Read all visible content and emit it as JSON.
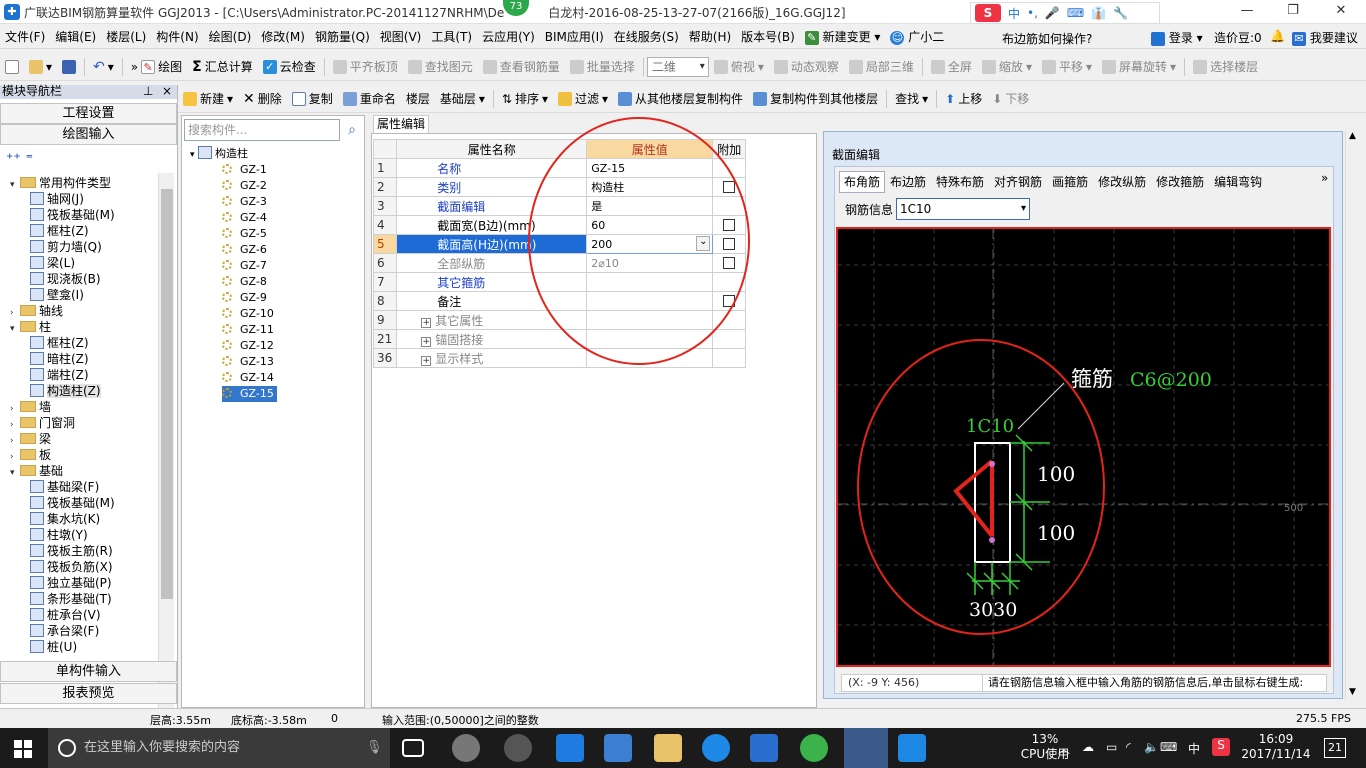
{
  "title_bar": {
    "title": "广联达BIM钢筋算量软件 GGJ2013 - [C:\\Users\\Administrator.PC-20141127NRHM\\De",
    "title_tail": "白龙村-2016-08-25-13-27-07(2166版)_16G.GGJ12]",
    "badge": "73",
    "ime_items": [
      "中",
      "•,",
      "🎤",
      "⌨",
      "👔",
      "🔧"
    ],
    "minimize": "—",
    "maximize": "❐",
    "close": "✕"
  },
  "menu": {
    "items": [
      "文件(F)",
      "编辑(E)",
      "楼层(L)",
      "构件(N)",
      "绘图(D)",
      "修改(M)",
      "钢筋量(Q)",
      "视图(V)",
      "工具(T)",
      "云应用(Y)",
      "BIM应用(I)",
      "在线服务(S)",
      "帮助(H)",
      "版本号(B)",
      "新建变更 ▾",
      "广小二"
    ],
    "help_question": "布边筋如何操作?",
    "login": "登录 ▾",
    "price_beans": "造价豆:0",
    "suggest": "我要建议"
  },
  "toolbar1": {
    "draw": "绘图",
    "summary": "汇总计算",
    "cloud_check": "云检查",
    "flush_slab": "平齐板顶",
    "find_element": "查找图元",
    "view_rebar": "查看钢筋量",
    "batch_select": "批量选择",
    "view_mode": "二维",
    "top_view": "俯视",
    "dynamic_view": "动态观察",
    "local_3d": "局部三维",
    "full_screen": "全屏",
    "zoom": "缩放",
    "pan": "平移",
    "rotate": "屏幕旋转",
    "select_floor": "选择楼层"
  },
  "toolbar2": {
    "new": "新建",
    "delete": "删除",
    "copy": "复制",
    "rename": "重命名",
    "floor_label": "楼层",
    "floor_value": "基础层",
    "sort": "排序",
    "filter": "过滤",
    "copy_from_floor": "从其他楼层复制构件",
    "copy_to_floor": "复制构件到其他楼层",
    "find": "查找",
    "move_up": "上移",
    "move_down": "下移"
  },
  "left_panel": {
    "header": "模块导航栏",
    "project_settings": "工程设置",
    "drawing_input": "绘图输入",
    "single_input": "单构件输入",
    "report_preview": "报表预览",
    "tree": [
      {
        "label": "常用构件类型",
        "level": 0,
        "type": "folder",
        "expanded": true
      },
      {
        "label": "轴网(J)",
        "level": 1,
        "type": "item"
      },
      {
        "label": "筏板基础(M)",
        "level": 1,
        "type": "item"
      },
      {
        "label": "框柱(Z)",
        "level": 1,
        "type": "item"
      },
      {
        "label": "剪力墙(Q)",
        "level": 1,
        "type": "item"
      },
      {
        "label": "梁(L)",
        "level": 1,
        "type": "item"
      },
      {
        "label": "现浇板(B)",
        "level": 1,
        "type": "item"
      },
      {
        "label": "壁龛(I)",
        "level": 1,
        "type": "item"
      },
      {
        "label": "轴线",
        "level": 0,
        "type": "folder",
        "expanded": false
      },
      {
        "label": "柱",
        "level": 0,
        "type": "folder",
        "expanded": true
      },
      {
        "label": "框柱(Z)",
        "level": 1,
        "type": "item"
      },
      {
        "label": "暗柱(Z)",
        "level": 1,
        "type": "item"
      },
      {
        "label": "端柱(Z)",
        "level": 1,
        "type": "item"
      },
      {
        "label": "构造柱(Z)",
        "level": 1,
        "type": "item",
        "selected": true
      },
      {
        "label": "墙",
        "level": 0,
        "type": "folder",
        "expanded": false
      },
      {
        "label": "门窗洞",
        "level": 0,
        "type": "folder",
        "expanded": false
      },
      {
        "label": "梁",
        "level": 0,
        "type": "folder",
        "expanded": false
      },
      {
        "label": "板",
        "level": 0,
        "type": "folder",
        "expanded": false
      },
      {
        "label": "基础",
        "level": 0,
        "type": "folder",
        "expanded": true
      },
      {
        "label": "基础梁(F)",
        "level": 1,
        "type": "item"
      },
      {
        "label": "筏板基础(M)",
        "level": 1,
        "type": "item"
      },
      {
        "label": "集水坑(K)",
        "level": 1,
        "type": "item"
      },
      {
        "label": "柱墩(Y)",
        "level": 1,
        "type": "item"
      },
      {
        "label": "筏板主筋(R)",
        "level": 1,
        "type": "item"
      },
      {
        "label": "筏板负筋(X)",
        "level": 1,
        "type": "item"
      },
      {
        "label": "独立基础(P)",
        "level": 1,
        "type": "item"
      },
      {
        "label": "条形基础(T)",
        "level": 1,
        "type": "item"
      },
      {
        "label": "桩承台(V)",
        "level": 1,
        "type": "item"
      },
      {
        "label": "承台梁(F)",
        "level": 1,
        "type": "item"
      },
      {
        "label": "桩(U)",
        "level": 1,
        "type": "item"
      }
    ]
  },
  "component_list": {
    "search_placeholder": "搜索构件...",
    "root": "构造柱",
    "items": [
      "GZ-1",
      "GZ-2",
      "GZ-3",
      "GZ-4",
      "GZ-5",
      "GZ-6",
      "GZ-7",
      "GZ-8",
      "GZ-9",
      "GZ-10",
      "GZ-11",
      "GZ-12",
      "GZ-13",
      "GZ-14",
      "GZ-15"
    ],
    "selected": "GZ-15"
  },
  "properties": {
    "tab": "属性编辑",
    "headers": {
      "name": "属性名称",
      "value": "属性值",
      "extra": "附加"
    },
    "rows": [
      {
        "num": "1",
        "name": "名称",
        "value": "GZ-15",
        "check": false,
        "style": "blue"
      },
      {
        "num": "2",
        "name": "类别",
        "value": "构造柱",
        "check": true,
        "style": "blue"
      },
      {
        "num": "3",
        "name": "截面编辑",
        "value": "是",
        "check": false,
        "style": "blue"
      },
      {
        "num": "4",
        "name": "截面宽(B边)(mm)",
        "value": "60",
        "check": true,
        "style": "black"
      },
      {
        "num": "5",
        "name": "截面高(H边)(mm)",
        "value": "200",
        "check": true,
        "style": "selected"
      },
      {
        "num": "6",
        "name": "全部纵筋",
        "value": "2⌀10",
        "check": true,
        "style": "grey"
      },
      {
        "num": "7",
        "name": "其它箍筋",
        "value": "",
        "check": false,
        "style": "blue"
      },
      {
        "num": "8",
        "name": "备注",
        "value": "",
        "check": true,
        "style": "black"
      },
      {
        "num": "9",
        "name": "其它属性",
        "value": "",
        "check": false,
        "style": "group"
      },
      {
        "num": "21",
        "name": "锚固搭接",
        "value": "",
        "check": false,
        "style": "group"
      },
      {
        "num": "36",
        "name": "显示样式",
        "value": "",
        "check": false,
        "style": "group"
      }
    ]
  },
  "section_editor": {
    "caption": "截面编辑",
    "tabs": [
      "布角筋",
      "布边筋",
      "特殊布筋",
      "对齐钢筋",
      "画箍筋",
      "修改纵筋",
      "修改箍筋",
      "编辑弯钩"
    ],
    "more": "»",
    "rebar_info_label": "钢筋信息",
    "rebar_info_value": "1C10",
    "canvas_labels": {
      "stirrup_label": "箍筋",
      "stirrup_value": "C6@200",
      "corner_rebar": "1C10",
      "dim_top": "100",
      "dim_bottom": "100",
      "dim_width": "3030",
      "axis_tick": "500",
      "origin": "0"
    },
    "coords": "(X: -9 Y: 456)",
    "hint": "请在钢筋信息输入框中输入角筋的钢筋信息后,单击鼠标右键生成:"
  },
  "status_bar": {
    "floor_height": "层高:3.55m",
    "bottom_height": "底标高:-3.58m",
    "zero": "0",
    "input_range": "输入范围:(0,50000]之间的整数",
    "fps": "275.5 FPS"
  },
  "taskbar": {
    "search_placeholder": "在这里输入你要搜索的内容",
    "cpu_percent": "13%",
    "cpu_label": "CPU使用",
    "ime": "中",
    "time": "16:09",
    "date": "2017/11/14",
    "notifications": "21"
  }
}
